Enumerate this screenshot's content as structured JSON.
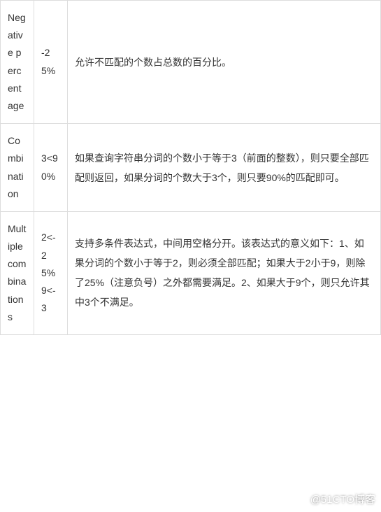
{
  "rows": [
    {
      "name": "Negative percentage",
      "value": "-25%",
      "description": "允许不匹配的个数占总数的百分比。"
    },
    {
      "name": "Combination",
      "value": "3<90%",
      "description": "如果查询字符串分词的个数小于等于3（前面的整数），则只要全部匹配则返回，如果分词的个数大于3个，则只要90%的匹配即可。"
    },
    {
      "name": "Multiple combinations",
      "value": "2<-25% 9<-3",
      "description": "支持多条件表达式，中间用空格分开。该表达式的意义如下：1、如果分词的个数小于等于2，则必须全部匹配；如果大于2小于9，则除了25%（注意负号）之外都需要满足。2、如果大于9个，则只允许其中3个不满足。"
    }
  ],
  "watermark": "@51CTO博客"
}
